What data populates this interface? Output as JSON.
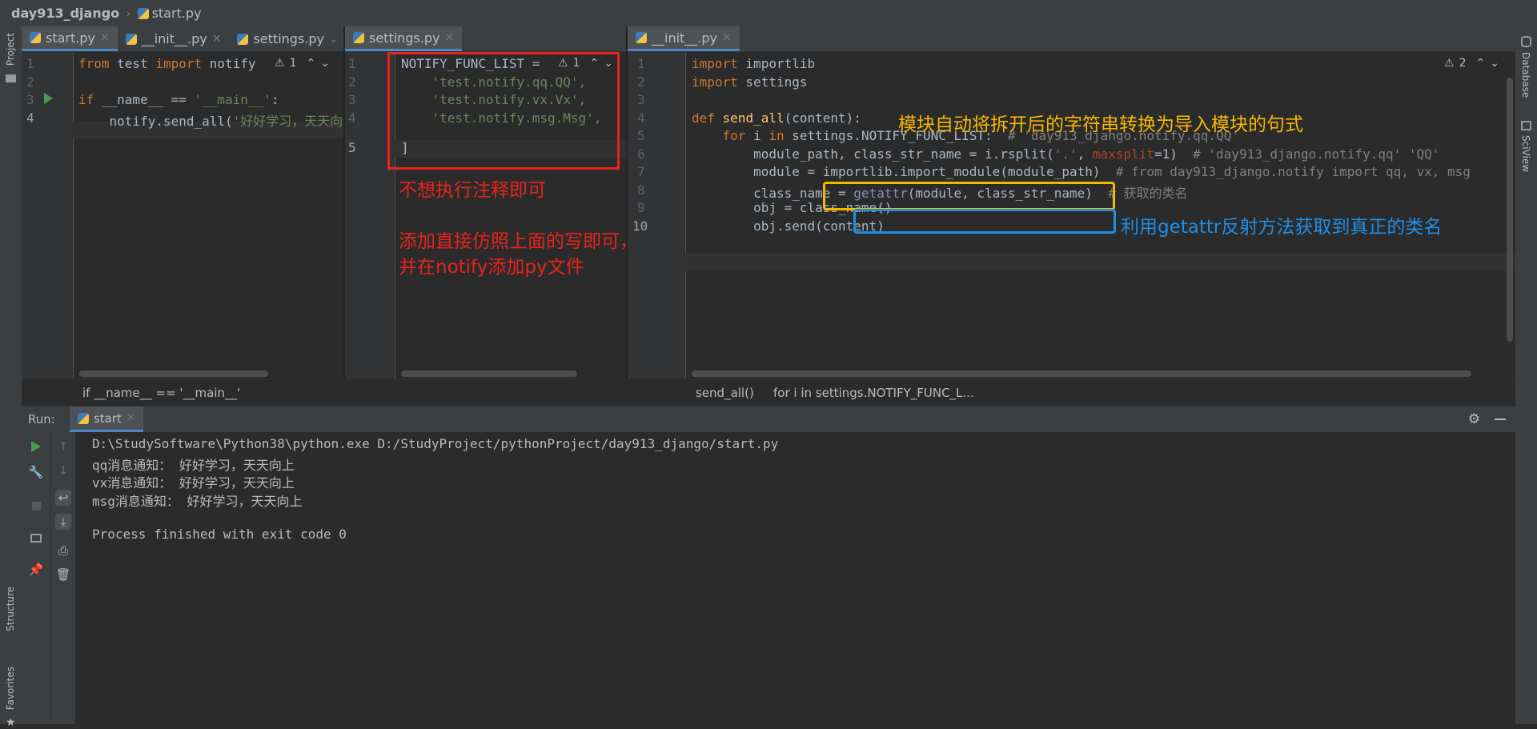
{
  "navbar": {
    "project": "day913_django",
    "file": "start.py"
  },
  "left_strip": {
    "project_label": "Project",
    "structure_label": "Structure",
    "favorites_label": "Favorites"
  },
  "right_strip": {
    "database_label": "Database",
    "sciview_label": "SciView"
  },
  "pane1": {
    "tabs": [
      "start.py",
      "__init__.py",
      "settings.py"
    ],
    "line_numbers": [
      "1",
      "2",
      "3",
      "4"
    ],
    "code": {
      "l1_kw1": "from",
      "l1_mod": " test ",
      "l1_kw2": "import",
      "l1_name": " notify",
      "l3_kw": "if",
      "l3_a": " __name__ == ",
      "l3_str": "'__main__'",
      "l3_b": ":",
      "l4_a": "    notify.send_all(",
      "l4_str": "'好好学习，天天向"
    },
    "warning_count": "1",
    "breadcrumb": "if __name__ == '__main__'"
  },
  "pane2": {
    "tabs": [
      "settings.py"
    ],
    "line_numbers": [
      "1",
      "2",
      "3",
      "4",
      "5"
    ],
    "code": {
      "l1": "NOTIFY_FUNC_LIST = ",
      "l2": "    'test.notify.qq.QQ',",
      "l3": "    'test.notify.vx.Vx',",
      "l4": "    'test.notify.msg.Msg',",
      "l5": "]"
    },
    "warning_count": "1"
  },
  "pane3": {
    "tabs": [
      "__init__.py"
    ],
    "line_numbers": [
      "1",
      "2",
      "3",
      "4",
      "5",
      "6",
      "7",
      "8",
      "9",
      "10"
    ],
    "code": {
      "l1_kw": "import",
      "l1_rest": " importlib",
      "l2_kw": "import",
      "l2_rest": " settings",
      "l4_kw": "def",
      "l4_fn": "send_all",
      "l4_rest": "(content):",
      "l5_kw1": "for",
      "l5_a": " i ",
      "l5_kw2": "in",
      "l5_b": " settings.NOTIFY_FUNC_LIST:  ",
      "l5_cm": "# 'day913_django.notify.qq.QQ'",
      "l6_a": "        module_path, class_str_name = i.rsplit(",
      "l6_str": "'.'",
      "l6_b": ", ",
      "l6_pm": "maxsplit",
      "l6_c": "=1)  ",
      "l6_cm": "# 'day913_django.notify.qq' 'QQ'",
      "l7_a": "        module = importlib.import_module(module_path)  ",
      "l7_cm": "# from day913_django.notify import qq, vx, msg",
      "l8_a": "        class_name = ",
      "l8_fn": "getattr",
      "l8_b": "(module, class_str_name)",
      "l8_cm": "  # 获取的类名",
      "l9": "        obj = class_name()",
      "l10": "        obj.send(content)"
    },
    "warning_count": "2",
    "breadcrumb_a": "send_all()",
    "breadcrumb_b": "for i in settings.NOTIFY_FUNC_L..."
  },
  "annotations": {
    "red1": "不想执行注释即可",
    "red2": "添加直接仿照上面的写即可，",
    "red3": "并在notify添加py文件",
    "yellow": "模块自动将拆开后的字符串转换为导入模块的句式",
    "blue": "利用getattr反射方法获取到真正的类名",
    "colors": {
      "red": "#e8231e",
      "yellow": "#f5b800",
      "blue": "#1e8fe8"
    }
  },
  "run": {
    "label": "Run:",
    "tab": "start",
    "output": [
      "D:\\StudySoftware\\Python38\\python.exe D:/StudyProject/pythonProject/day913_django/start.py",
      "qq消息通知： 好好学习，天天向上",
      "vx消息通知： 好好学习，天天向上",
      "msg消息通知： 好好学习，天天向上",
      "",
      "Process finished with exit code 0"
    ]
  }
}
